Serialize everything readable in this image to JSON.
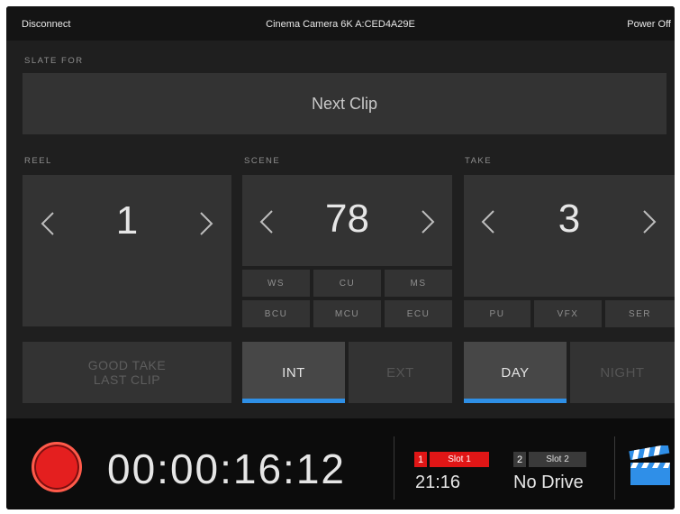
{
  "topbar": {
    "disconnect": "Disconnect",
    "camera_name": "Cinema Camera 6K A:CED4A29E",
    "power_off": "Power Off"
  },
  "slate": {
    "label": "SLATE FOR",
    "target": "Next Clip"
  },
  "reel": {
    "label": "REEL",
    "value": "1"
  },
  "scene": {
    "label": "SCENE",
    "value": "78",
    "tags_row1": [
      "WS",
      "CU",
      "MS"
    ],
    "tags_row2": [
      "BCU",
      "MCU",
      "ECU"
    ]
  },
  "take": {
    "label": "TAKE",
    "value": "3",
    "tags": [
      "PU",
      "VFX",
      "SER"
    ]
  },
  "good_take": {
    "line1": "GOOD TAKE",
    "line2": "LAST CLIP"
  },
  "int_ext": {
    "int": "INT",
    "ext": "EXT",
    "selected": "INT"
  },
  "day_night": {
    "day": "DAY",
    "night": "NIGHT",
    "selected": "DAY"
  },
  "status": {
    "timecode": "00:00:16:12",
    "slot1": {
      "number": "1",
      "name": "Slot 1",
      "value": "21:16",
      "color": "#e01616"
    },
    "slot2": {
      "number": "2",
      "name": "Slot 2",
      "value": "No Drive",
      "color": "#3a3a3a"
    }
  },
  "colors": {
    "accent": "#2e8fe6",
    "record": "#e41f1f",
    "panel": "#333333",
    "background": "#1f1f1f"
  },
  "icons": {
    "left_arrow": "chevron-left-icon",
    "right_arrow": "chevron-right-icon",
    "record": "record-icon",
    "slate": "clapperboard-icon"
  }
}
